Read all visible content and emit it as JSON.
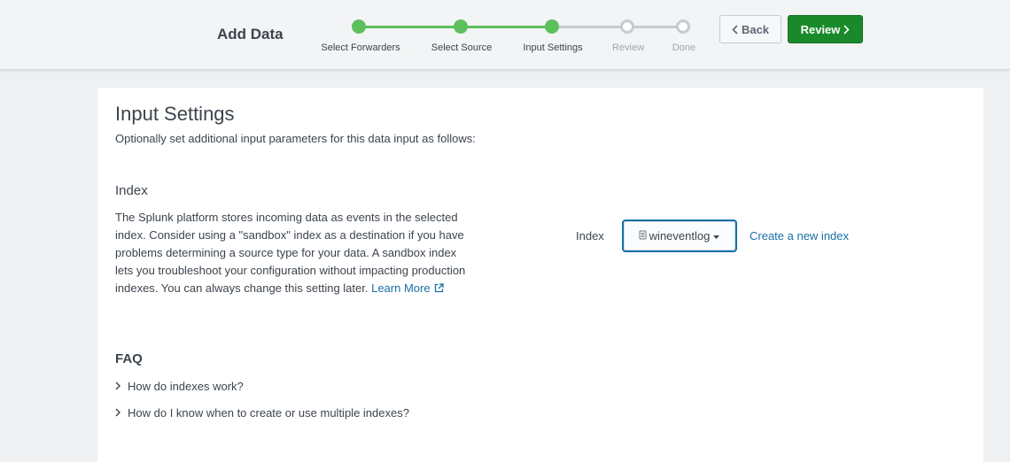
{
  "header": {
    "title": "Add Data",
    "steps": [
      {
        "label": "Select Forwarders",
        "status": "complete"
      },
      {
        "label": "Select Source",
        "status": "complete"
      },
      {
        "label": "Input Settings",
        "status": "current"
      },
      {
        "label": "Review",
        "status": "pending"
      },
      {
        "label": "Done",
        "status": "pending"
      }
    ],
    "back_label": "Back",
    "review_label": "Review"
  },
  "main": {
    "title": "Input Settings",
    "subtitle": "Optionally set additional input parameters for this data input as follows:",
    "index_section": {
      "title": "Index",
      "description": "The Splunk platform stores incoming data as events in the selected index. Consider using a \"sandbox\" index as a destination if you have problems determining a source type for your data. A sandbox index lets you troubleshoot your configuration without impacting production indexes. You can always change this setting later.",
      "learn_more": "Learn More",
      "field_label": "Index",
      "selected_index": "wineventlog",
      "create_link": "Create a new index"
    },
    "faq": {
      "title": "FAQ",
      "questions": [
        "How do indexes work?",
        "How do I know when to create or use multiple indexes?"
      ]
    }
  },
  "colors": {
    "complete": "#5cc05c",
    "pending": "#c3cbd4",
    "primary_button": "#1a8929",
    "link": "#1a6fa6"
  },
  "icons": {
    "back": "chevron-left-icon",
    "review": "chevron-right-icon",
    "external": "external-link-icon",
    "select_prefix": "database-icon",
    "select_caret": "caret-down-icon",
    "faq_toggle": "chevron-right-icon"
  }
}
